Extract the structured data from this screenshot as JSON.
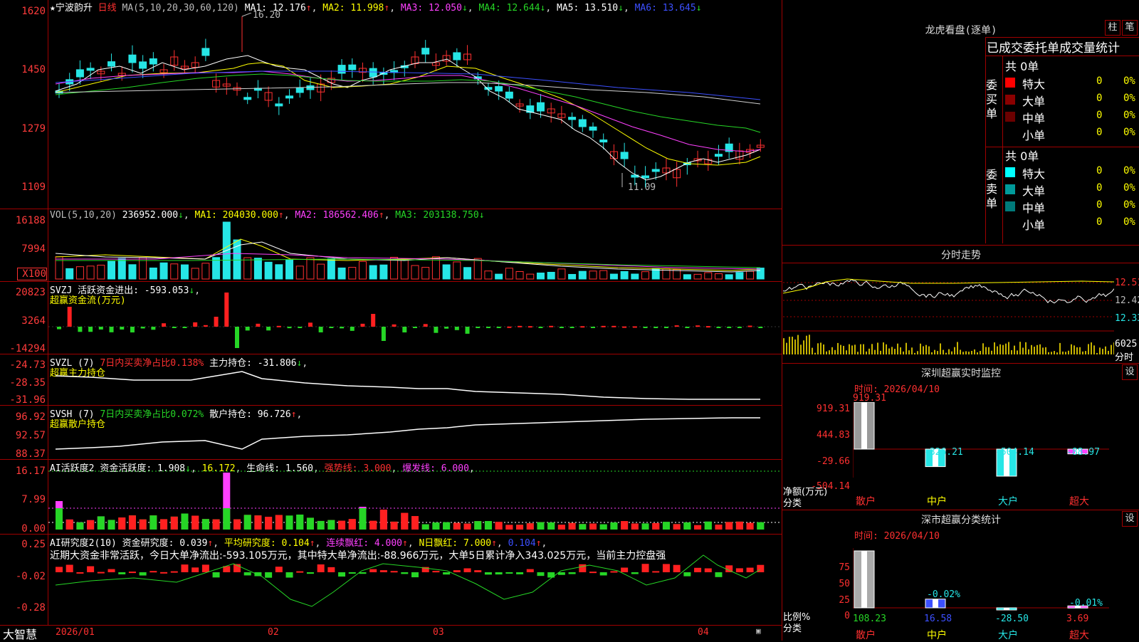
{
  "stock": {
    "name": "★宁波韵升",
    "period": "日线"
  },
  "main": {
    "ma_label": "MA(5,10,20,30,60,120)",
    "ma1": "MA1: 12.176",
    "ma2": "MA2: 11.998",
    "ma3": "MA3: 12.050",
    "ma4": "MA4: 12.644",
    "ma5": "MA5: 13.510",
    "ma6": "MA6: 13.645",
    "high_mark": "16.20",
    "low_mark": "11.09",
    "axis": [
      "1620",
      "1450",
      "1279",
      "1109"
    ]
  },
  "vol": {
    "label": "VOL(5,10,20)",
    "v": "236952.000",
    "ma1": "MA1: 204030.000",
    "ma2": "MA2: 186562.406",
    "ma3": "MA3: 203138.750",
    "axis": [
      "16188",
      "7994",
      "X100"
    ]
  },
  "svzj": {
    "label": "SVZJ",
    "t1": "活跃资金进出: -593.053",
    "t2": "超赢资金流(万元)",
    "axis": [
      "20823",
      "3264",
      "-14294"
    ]
  },
  "svzl": {
    "label": "SVZL (7)",
    "t1": "7日内买卖净占比0.138%",
    "t2": "主力持仓: -31.806",
    "t3": "超赢主力持仓",
    "axis": [
      "-24.73",
      "-28.35",
      "-31.96"
    ]
  },
  "svsh": {
    "label": "SVSH (7)",
    "t1": "7日内买卖净占比0.072%",
    "t2": "散户持仓: 96.726",
    "t3": "超赢散户持仓",
    "axis": [
      "96.92",
      "92.57",
      "88.37"
    ]
  },
  "ai1": {
    "label": "AI活跃度2",
    "t1": "资金活跃度: 1.908",
    "t2": "16.172",
    "t3": "生命线: 1.560",
    "t4": "强势线: 3.000",
    "t5": "爆发线: 6.000",
    "axis": [
      "16.17",
      "7.99",
      "0.00"
    ]
  },
  "ai2": {
    "label": "AI研究度2(10)",
    "t1": "资金研究度: 0.039",
    "t2": "平均研究度: 0.104",
    "t3": "连续飘红: 4.000",
    "t4": "N日飘红: 7.000",
    "t5": "0.104",
    "msg": "近期大资金非常活跃，今日大单净流出:-593.105万元，其中特大单净流出:-88.966万元，大单5日累计净入343.025万元，当前主力控盘强",
    "axis": [
      "0.25",
      "-0.02",
      "-0.28"
    ]
  },
  "xaxis": {
    "labels": [
      "2026/01",
      "02",
      "03",
      "04"
    ]
  },
  "brand": "大智慧",
  "dragon": {
    "title": "龙虎看盘(逐单)",
    "btn1": "柱",
    "btn2": "笔",
    "header": "已成交委托单成交量统计",
    "buy": {
      "side": "委买单",
      "total": "共 0单",
      "rows": [
        {
          "name": "特大",
          "v": "0",
          "p": "0%",
          "color": "#ff0000"
        },
        {
          "name": "大单",
          "v": "0",
          "p": "0%",
          "color": "#8b0000"
        },
        {
          "name": "中单",
          "v": "0",
          "p": "0%",
          "color": "#6b0000"
        },
        {
          "name": "小单",
          "v": "0",
          "p": "0%",
          "color": "#000000"
        }
      ]
    },
    "sell": {
      "side": "委卖单",
      "total": "共 0单",
      "rows": [
        {
          "name": "特大",
          "v": "0",
          "p": "0%",
          "color": "#00ffff"
        },
        {
          "name": "大单",
          "v": "0",
          "p": "0%",
          "color": "#009a9a"
        },
        {
          "name": "中单",
          "v": "0",
          "p": "0%",
          "color": "#007a7a"
        },
        {
          "name": "小单",
          "v": "0",
          "p": "0%",
          "color": "#000000"
        }
      ]
    }
  },
  "intraday": {
    "title": "分时走势",
    "axis": [
      "12.51",
      "12.42",
      "12.33",
      "6025",
      "分时"
    ]
  },
  "monitor": {
    "title": "深圳超赢实时监控",
    "btn": "设",
    "time": "时间: 2026/04/10",
    "axis": [
      "919.31",
      "444.83",
      "-29.66",
      "-504.14"
    ],
    "ylabel": "净额(万元)",
    "xlabel": "分类",
    "cats": [
      "散户",
      "中户",
      "大户",
      "超大"
    ],
    "vals": [
      "919.31",
      "-326.21",
      "-504.14",
      "-88.97"
    ]
  },
  "classstat": {
    "title": "深市超赢分类统计",
    "btn": "设",
    "time": "时间: 2026/04/10",
    "axis": [
      "75",
      "50",
      "25",
      "0"
    ],
    "ylabel": "比例%",
    "xlabel": "分类",
    "cats": [
      "散户",
      "中户",
      "大户",
      "超大"
    ],
    "tops": [
      "",
      "-0.02%",
      "",
      "-0.01%"
    ],
    "vals": [
      "108.23",
      "16.58",
      "-28.50",
      "3.69"
    ]
  },
  "chart_data": [
    {
      "type": "candlestick",
      "title": "宁波韵升 日线",
      "ylim": [
        11.09,
        16.2
      ],
      "x_ticks": [
        "2026/01",
        "02",
        "03",
        "04"
      ]
    },
    {
      "type": "bar",
      "title": "深圳超赢实时监控",
      "categories": [
        "散户",
        "中户",
        "大户",
        "超大"
      ],
      "values": [
        919.31,
        -326.21,
        -504.14,
        -88.97
      ],
      "ylabel": "净额(万元)",
      "ylim": [
        -504.14,
        919.31
      ]
    },
    {
      "type": "bar",
      "title": "深市超赢分类统计",
      "categories": [
        "散户",
        "中户",
        "大户",
        "超大"
      ],
      "values": [
        108.23,
        16.58,
        -28.5,
        3.69
      ],
      "ylabel": "比例%"
    }
  ]
}
